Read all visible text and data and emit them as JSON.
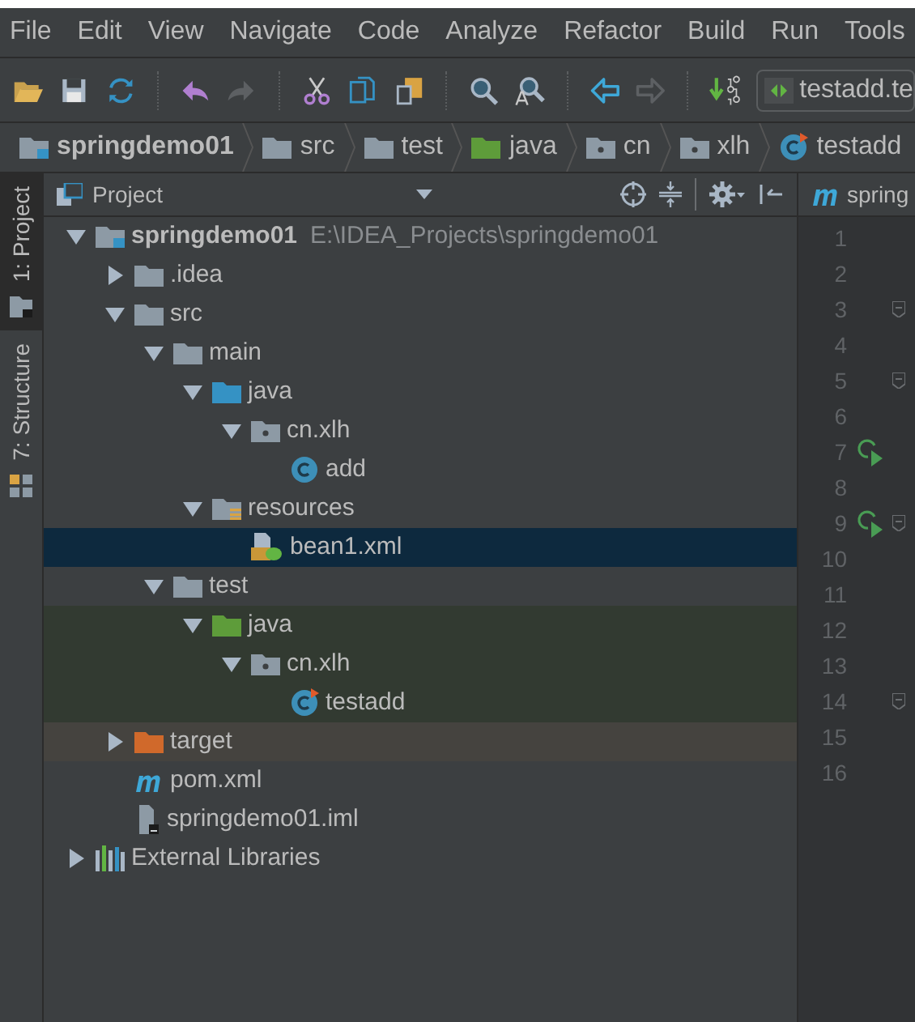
{
  "menu_bar": [
    "File",
    "Edit",
    "View",
    "Navigate",
    "Code",
    "Analyze",
    "Refactor",
    "Build",
    "Run",
    "Tools"
  ],
  "toolbar": {
    "buttons": [
      {
        "kind": "open"
      },
      {
        "kind": "save"
      },
      {
        "kind": "sync"
      },
      {
        "kind": "sep"
      },
      {
        "kind": "undo",
        "disabled": false
      },
      {
        "kind": "redo",
        "disabled": true
      },
      {
        "kind": "sep"
      },
      {
        "kind": "cut"
      },
      {
        "kind": "copy"
      },
      {
        "kind": "paste"
      },
      {
        "kind": "sep"
      },
      {
        "kind": "find"
      },
      {
        "kind": "replace"
      },
      {
        "kind": "sep"
      },
      {
        "kind": "back",
        "disabled": false
      },
      {
        "kind": "forward",
        "disabled": true
      },
      {
        "kind": "sep"
      },
      {
        "kind": "build"
      }
    ],
    "run_config": "testadd.te"
  },
  "breadcrumbs": [
    {
      "label": "springdemo01",
      "kind": "module"
    },
    {
      "label": "src",
      "kind": "folder"
    },
    {
      "label": "test",
      "kind": "folder"
    },
    {
      "label": "java",
      "kind": "test-root"
    },
    {
      "label": "cn",
      "kind": "package"
    },
    {
      "label": "xlh",
      "kind": "package"
    },
    {
      "label": "testadd",
      "kind": "test-class"
    }
  ],
  "side_tabs": [
    {
      "label": "1: Project",
      "kind": "project",
      "selected": true
    },
    {
      "label": "7: Structure",
      "kind": "structure",
      "selected": false
    }
  ],
  "project_panel": {
    "title": "Project",
    "tree": [
      {
        "label": "springdemo01",
        "path": "E:\\IDEA_Projects\\springdemo01",
        "kind": "module",
        "expanded": true,
        "selected": false,
        "children": [
          {
            "label": ".idea",
            "kind": "folder",
            "expanded": false,
            "selected": false
          },
          {
            "label": "src",
            "kind": "folder",
            "expanded": true,
            "selected": false,
            "children": [
              {
                "label": "main",
                "kind": "folder",
                "expanded": true,
                "selected": false,
                "children": [
                  {
                    "label": "java",
                    "kind": "source-root",
                    "expanded": true,
                    "selected": false,
                    "children": [
                      {
                        "label": "cn.xlh",
                        "kind": "package",
                        "expanded": true,
                        "selected": false,
                        "children": [
                          {
                            "label": "add",
                            "kind": "class",
                            "selected": false
                          }
                        ]
                      }
                    ]
                  },
                  {
                    "label": "resources",
                    "kind": "resources-root",
                    "expanded": true,
                    "selected": false,
                    "children": [
                      {
                        "label": "bean1.xml",
                        "kind": "xml",
                        "selected": true
                      }
                    ]
                  }
                ]
              },
              {
                "label": "test",
                "kind": "folder",
                "expanded": true,
                "selected": false,
                "children": [
                  {
                    "label": "java",
                    "kind": "test-root",
                    "test": true,
                    "expanded": true,
                    "selected": false,
                    "children": [
                      {
                        "label": "cn.xlh",
                        "kind": "package",
                        "test": true,
                        "expanded": true,
                        "selected": false,
                        "children": [
                          {
                            "label": "testadd",
                            "kind": "test-class",
                            "test": true,
                            "selected": false
                          }
                        ]
                      }
                    ]
                  }
                ]
              }
            ]
          },
          {
            "label": "target",
            "kind": "excluded",
            "excluded": true,
            "expanded": false,
            "selected": false
          },
          {
            "label": "pom.xml",
            "kind": "maven",
            "selected": false
          },
          {
            "label": "springdemo01.iml",
            "kind": "iml",
            "selected": false
          }
        ]
      },
      {
        "label": "External Libraries",
        "kind": "libraries",
        "expanded": false,
        "selected": false
      }
    ]
  },
  "editor": {
    "tab": "spring",
    "lines": [
      {
        "n": "1"
      },
      {
        "n": "2"
      },
      {
        "n": "3",
        "fold": true
      },
      {
        "n": "4"
      },
      {
        "n": "5",
        "fold": true
      },
      {
        "n": "6"
      },
      {
        "n": "7",
        "run": true
      },
      {
        "n": "8"
      },
      {
        "n": "9",
        "run": true,
        "fold": true
      },
      {
        "n": "10"
      },
      {
        "n": "11"
      },
      {
        "n": "12"
      },
      {
        "n": "13"
      },
      {
        "n": "14",
        "fold": true
      },
      {
        "n": "15"
      },
      {
        "n": "16"
      }
    ]
  }
}
